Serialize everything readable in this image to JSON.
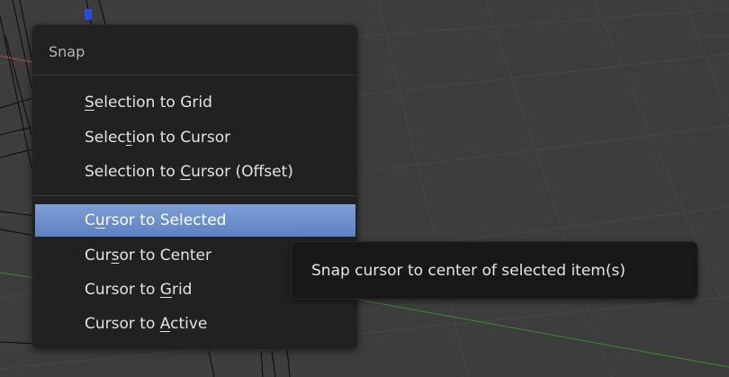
{
  "menu": {
    "title": "Snap",
    "items": [
      {
        "id": "selection-to-grid",
        "pre": "",
        "key": "S",
        "post": "election to Grid"
      },
      {
        "id": "selection-to-cursor",
        "pre": "Selec",
        "key": "t",
        "post": "ion to Cursor"
      },
      {
        "id": "selection-to-cursor-offset",
        "pre": "Selection to ",
        "key": "C",
        "post": "ursor (Offset)"
      },
      {
        "id": "cursor-to-selected",
        "pre": "C",
        "key": "u",
        "post": "rsor to Selected",
        "highlighted": true
      },
      {
        "id": "cursor-to-center",
        "pre": "Cur",
        "key": "s",
        "post": "or to Center"
      },
      {
        "id": "cursor-to-grid",
        "pre": "Cursor to ",
        "key": "G",
        "post": "rid"
      },
      {
        "id": "cursor-to-active",
        "pre": "Cursor to ",
        "key": "A",
        "post": "ctive"
      }
    ]
  },
  "tooltip": {
    "text": "Snap cursor to center of selected item(s)"
  },
  "colors": {
    "viewport_bg": "#3d3d3d",
    "menu_bg": "#212121",
    "highlight": "#6f93d0",
    "tooltip_bg": "#181818",
    "x_axis_red": "#b94a4a",
    "y_axis_green": "#3d8a2c",
    "z_axis_blue": "#2b4bd8"
  }
}
